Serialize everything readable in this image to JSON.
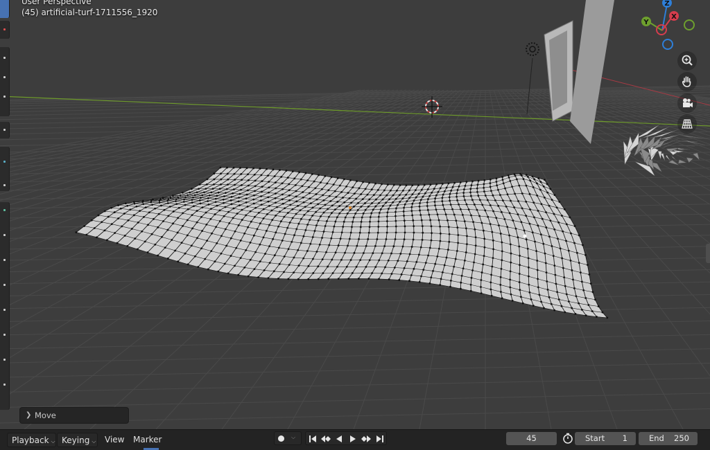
{
  "viewport": {
    "view_mode": "User Perspective",
    "object_info": "(45) artificial-turf-1711556_1920",
    "operator_panel": {
      "label": "Move",
      "collapsed_icon": "chevron-right-icon"
    }
  },
  "gizmo": {
    "axes": [
      {
        "label": "Z",
        "color": "#2e7fd9"
      },
      {
        "label": "Y",
        "color": "#6ea02e"
      },
      {
        "label": "X",
        "color": "#d63d4d"
      }
    ]
  },
  "nav_buttons": [
    {
      "name": "zoom-icon"
    },
    {
      "name": "pan-hand-icon"
    },
    {
      "name": "camera-icon"
    },
    {
      "name": "perspective-grid-icon"
    }
  ],
  "timeline": {
    "menus": {
      "playback": "Playback",
      "keying": "Keying",
      "view": "View",
      "marker": "Marker"
    },
    "current_frame": "45",
    "start_label": "Start",
    "start_value": "1",
    "end_label": "End",
    "end_value": "250"
  },
  "colors": {
    "grid_line": "#4a4a4a",
    "x_axis": "#a83a44",
    "y_axis": "#6e9b2a",
    "accent": "#4772b3",
    "mesh_face": "#cfcfcf",
    "mesh_vertex": "#111111"
  }
}
